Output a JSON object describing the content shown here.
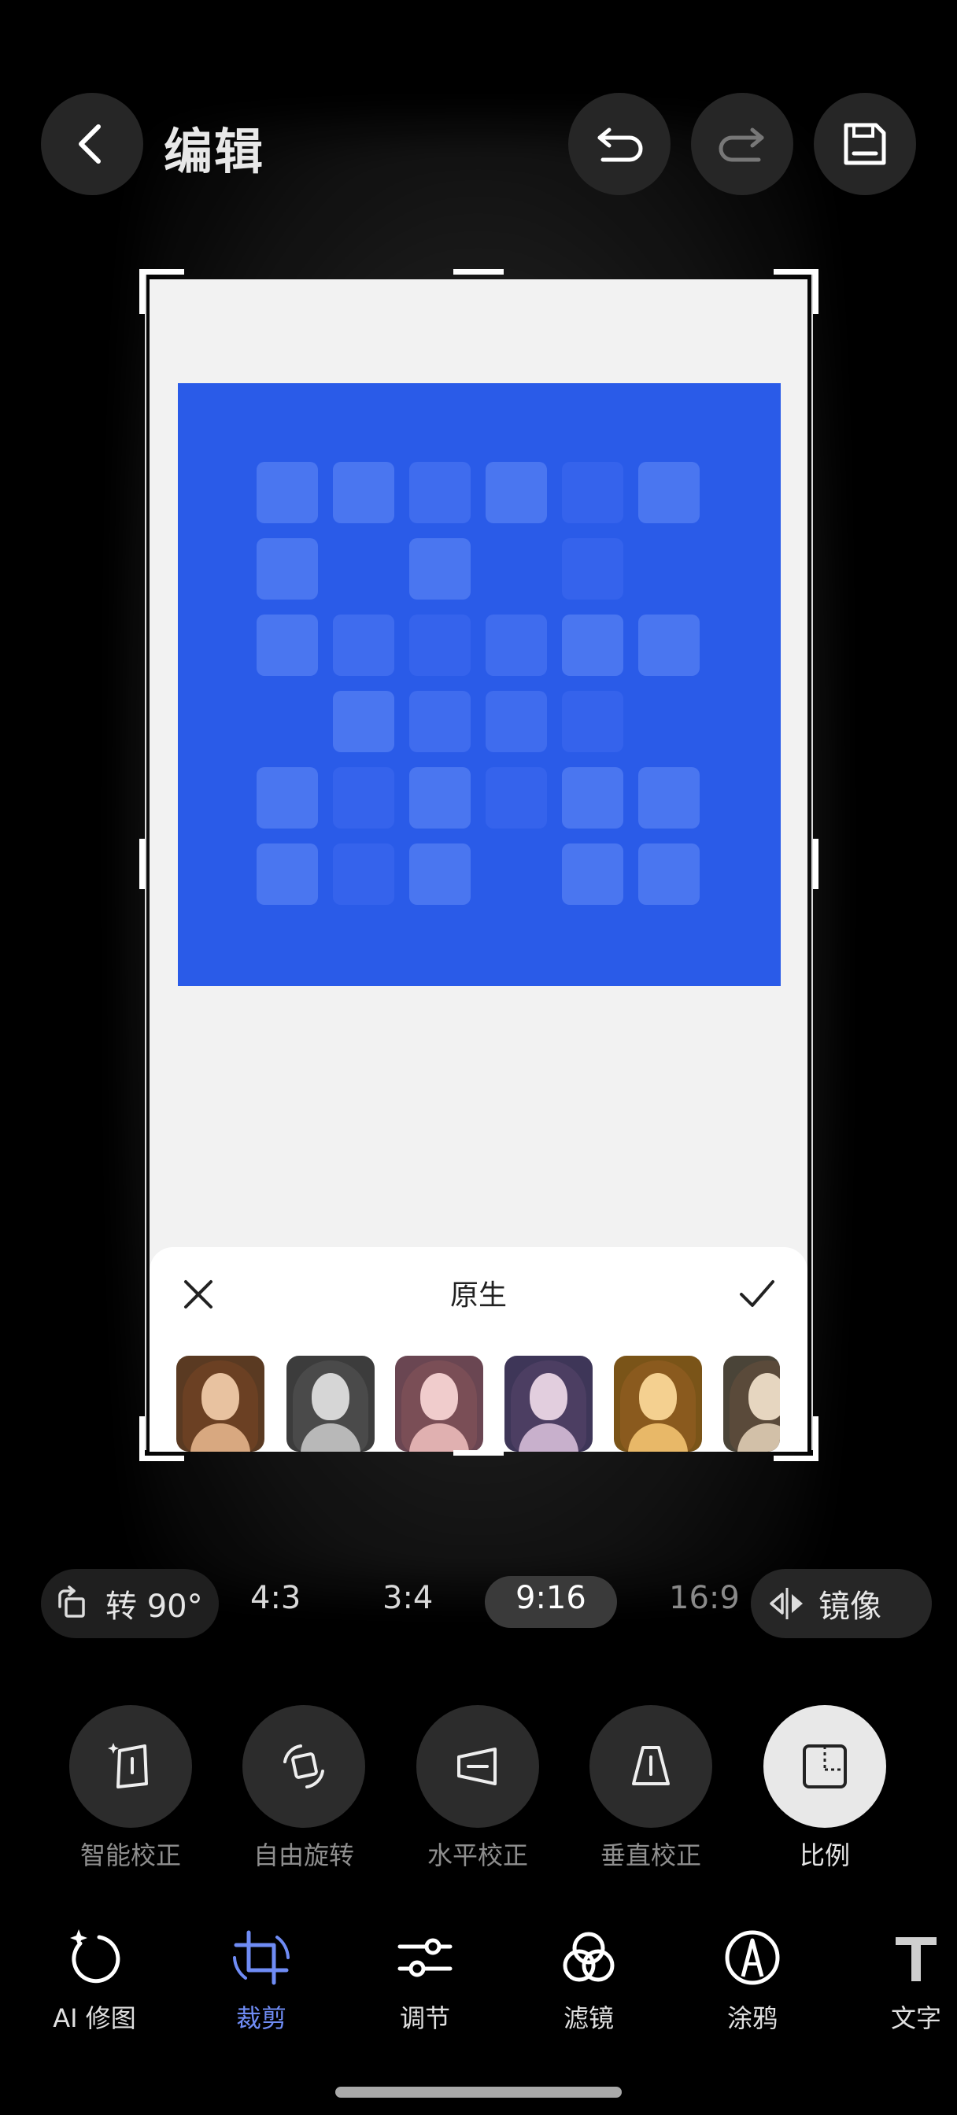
{
  "header": {
    "title": "编辑",
    "back_icon": "chevron-left-icon",
    "undo_icon": "undo-icon",
    "redo_icon": "redo-icon",
    "save_icon": "floppy-save-icon"
  },
  "filter_sheet": {
    "title": "原生",
    "cancel_icon": "close-icon",
    "confirm_icon": "check-icon",
    "thumbnails": [
      "portrait-filter-1",
      "portrait-filter-2",
      "portrait-filter-3",
      "portrait-filter-4",
      "portrait-filter-5",
      "portrait-filter-6"
    ]
  },
  "canvas": {
    "background_color": "#f2f2f2",
    "image_color": "#2a5be8"
  },
  "ratio_bar": {
    "rotate_label": "转 90°",
    "rotate_icon": "rotate-icon",
    "ratios": [
      "4:3",
      "3:4",
      "9:16",
      "16:9"
    ],
    "selected_ratio": "9:16",
    "mirror_label": "镜像",
    "mirror_icon": "mirror-flip-icon"
  },
  "crop_tools": [
    {
      "label": "智能校正",
      "icon": "smart-correct-icon",
      "active": false
    },
    {
      "label": "自由旋转",
      "icon": "free-rotate-icon",
      "active": false
    },
    {
      "label": "水平校正",
      "icon": "horizontal-correct-icon",
      "active": false
    },
    {
      "label": "垂直校正",
      "icon": "vertical-correct-icon",
      "active": false
    },
    {
      "label": "比例",
      "icon": "ratio-icon",
      "active": true
    }
  ],
  "bottom_nav": [
    {
      "label": "AI 修图",
      "icon": "ai-retouch-icon",
      "active": false
    },
    {
      "label": "裁剪",
      "icon": "crop-icon",
      "active": true
    },
    {
      "label": "调节",
      "icon": "adjust-sliders-icon",
      "active": false
    },
    {
      "label": "滤镜",
      "icon": "filter-icon",
      "active": false
    },
    {
      "label": "涂鸦",
      "icon": "doodle-pen-icon",
      "active": false
    },
    {
      "label": "文字",
      "icon": "text-icon",
      "active": false
    }
  ],
  "colors": {
    "accent": "#6f8cf5",
    "background": "#000000",
    "button": "#262626"
  }
}
